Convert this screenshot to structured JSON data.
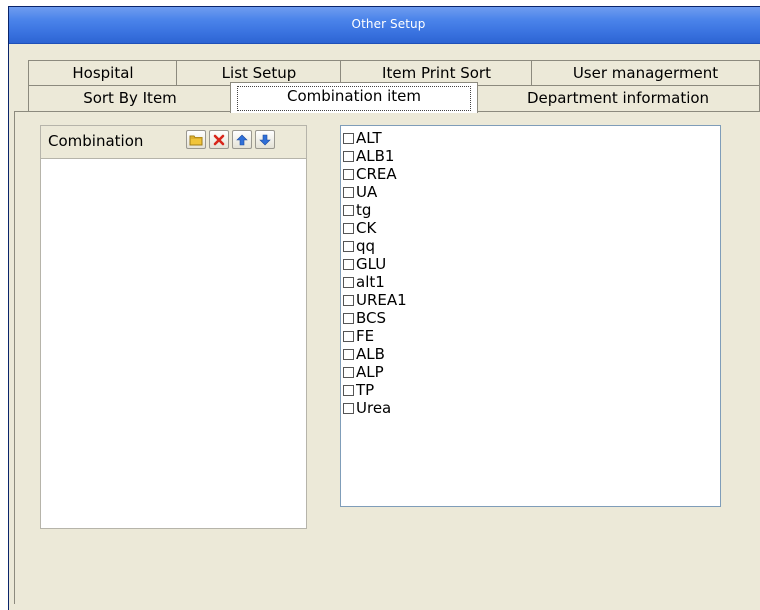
{
  "window": {
    "title": "Other Setup"
  },
  "tabs": {
    "row1": [
      "Hospital",
      "List Setup",
      "Item Print Sort",
      "User managerment"
    ],
    "row2": [
      "Sort By Item",
      "Combination item",
      "Department information"
    ],
    "active": "Combination item"
  },
  "combination_panel": {
    "label": "Combination",
    "toolbar_icons": [
      "folder-icon",
      "delete-icon",
      "arrow-up-icon",
      "arrow-down-icon"
    ]
  },
  "items": [
    {
      "label": "ALT",
      "checked": false
    },
    {
      "label": "ALB1",
      "checked": false
    },
    {
      "label": "CREA",
      "checked": false
    },
    {
      "label": "UA",
      "checked": false
    },
    {
      "label": "tg",
      "checked": false
    },
    {
      "label": "CK",
      "checked": false
    },
    {
      "label": "qq",
      "checked": false
    },
    {
      "label": "GLU",
      "checked": false
    },
    {
      "label": "alt1",
      "checked": false
    },
    {
      "label": "UREA1",
      "checked": false
    },
    {
      "label": "BCS",
      "checked": false
    },
    {
      "label": "FE",
      "checked": false
    },
    {
      "label": "ALB",
      "checked": false
    },
    {
      "label": "ALP",
      "checked": false
    },
    {
      "label": "TP",
      "checked": false
    },
    {
      "label": "Urea",
      "checked": false
    }
  ],
  "colors": {
    "titlebar": "#3a73e0",
    "face": "#ece9d8",
    "delete_red": "#d8261c",
    "arrow_blue": "#2f6fd8",
    "folder_yellow": "#f0c43a"
  }
}
